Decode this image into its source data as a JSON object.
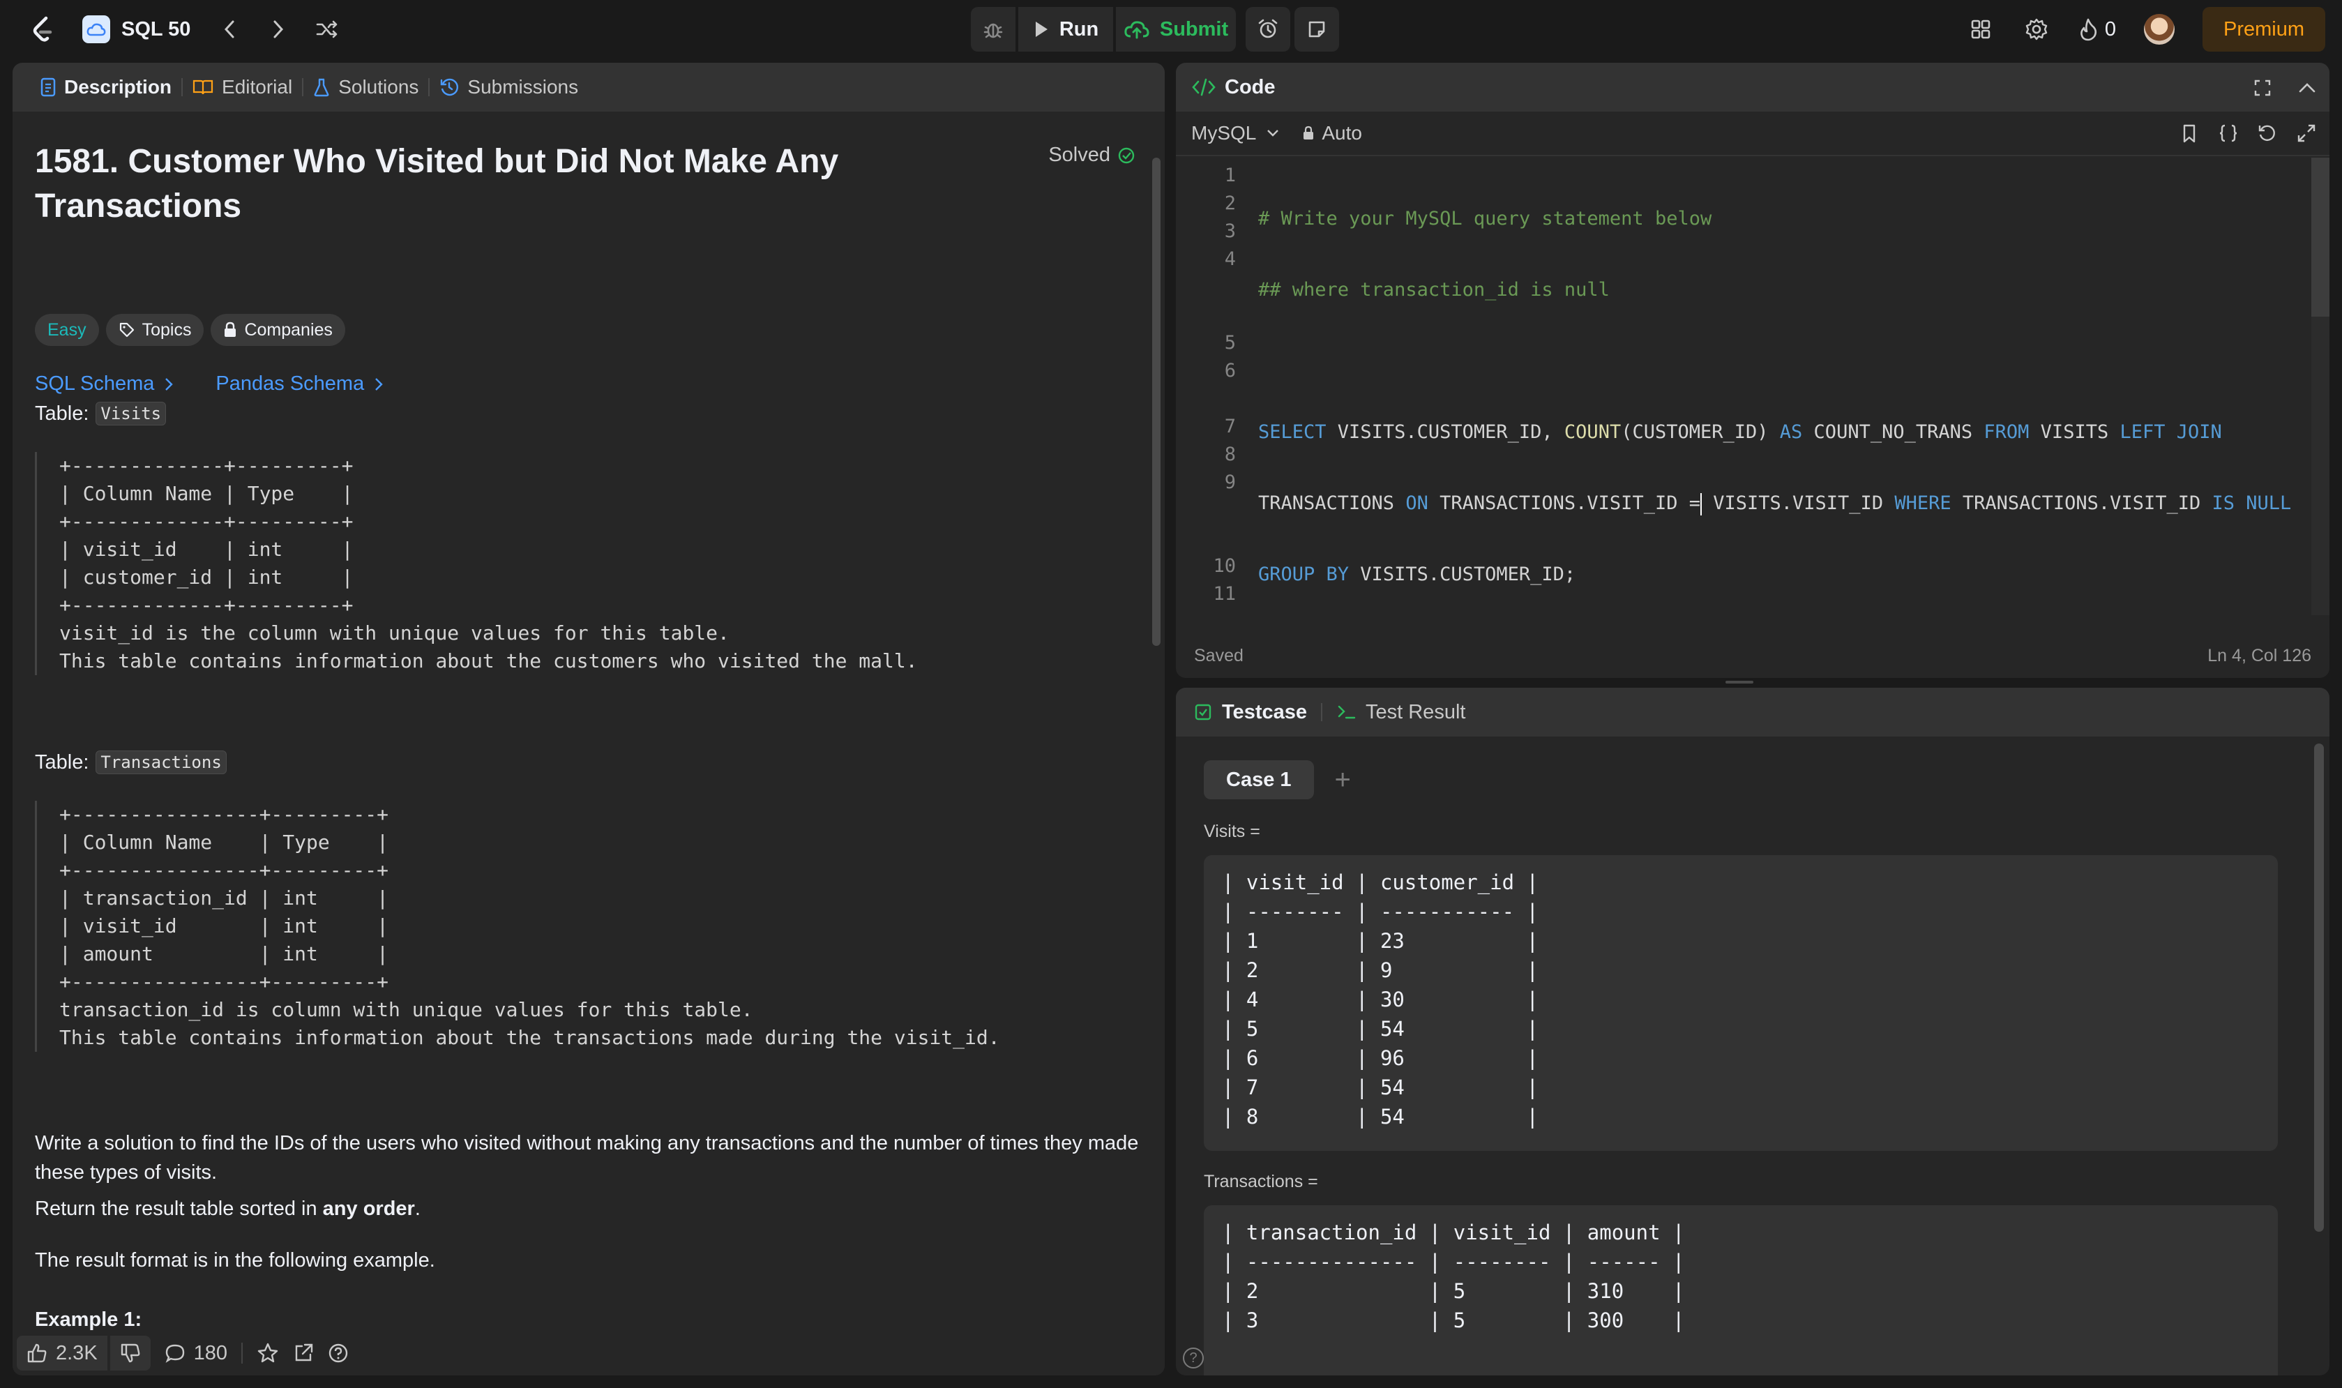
{
  "topbar": {
    "study_plan": "SQL 50",
    "run_label": "Run",
    "submit_label": "Submit",
    "streak_count": "0",
    "premium_label": "Premium"
  },
  "left_panel": {
    "tabs": {
      "description": "Description",
      "editorial": "Editorial",
      "solutions": "Solutions",
      "submissions": "Submissions"
    },
    "title_line1": "1581. Customer Who Visited but Did Not Make Any",
    "title_line2": "Transactions",
    "status": "Solved",
    "tags": {
      "difficulty": "Easy",
      "topics": "Topics",
      "companies": "Companies"
    },
    "schema_links": {
      "sql": "SQL Schema",
      "pandas": "Pandas Schema"
    },
    "table1_label": "Table:",
    "table1_name": "Visits",
    "table1_block": "+-------------+---------+\n| Column Name | Type    |\n+-------------+---------+\n| visit_id    | int     |\n| customer_id | int     |\n+-------------+---------+\nvisit_id is the column with unique values for this table.\nThis table contains information about the customers who visited the mall.",
    "table2_label": "Table:",
    "table2_name": "Transactions",
    "table2_block": "+----------------+---------+\n| Column Name    | Type    |\n+----------------+---------+\n| transaction_id | int     |\n| visit_id       | int     |\n| amount         | int     |\n+----------------+---------+\ntransaction_id is column with unique values for this table.\nThis table contains information about the transactions made during the visit_id.",
    "para1": "Write a solution to find the IDs of the users who visited without making any transactions and the number of times they made these types of visits.",
    "para2_pre": "Return the result table sorted in ",
    "para2_bold": "any order",
    "para2_post": ".",
    "para3": "The result format is in the following example.",
    "example_title": "Example 1:",
    "footer": {
      "likes": "2.3K",
      "comments": "180"
    }
  },
  "code_panel": {
    "title": "Code",
    "language": "MySQL",
    "auto_label": "Auto",
    "status": "Saved",
    "cursor_pos": "Ln 4, Col 126",
    "line_numbers": [
      "1",
      "2",
      "3",
      "4",
      "",
      "",
      "5",
      "6",
      "",
      "7",
      "8",
      "9",
      "",
      "",
      "10",
      "11"
    ]
  },
  "test_panel": {
    "tab_testcase": "Testcase",
    "tab_result": "Test Result",
    "case_label": "Case 1",
    "visits_label": "Visits =",
    "visits_table": "| visit_id | customer_id |\n| -------- | ----------- |\n| 1        | 23          |\n| 2        | 9           |\n| 4        | 30          |\n| 5        | 54          |\n| 6        | 96          |\n| 7        | 54          |\n| 8        | 54          |",
    "transactions_label": "Transactions =",
    "transactions_table": "| transaction_id | visit_id | amount |\n| -------------- | -------- | ------ |\n| 2              | 5        | 310    |\n| 3              | 5        | 300    |"
  }
}
